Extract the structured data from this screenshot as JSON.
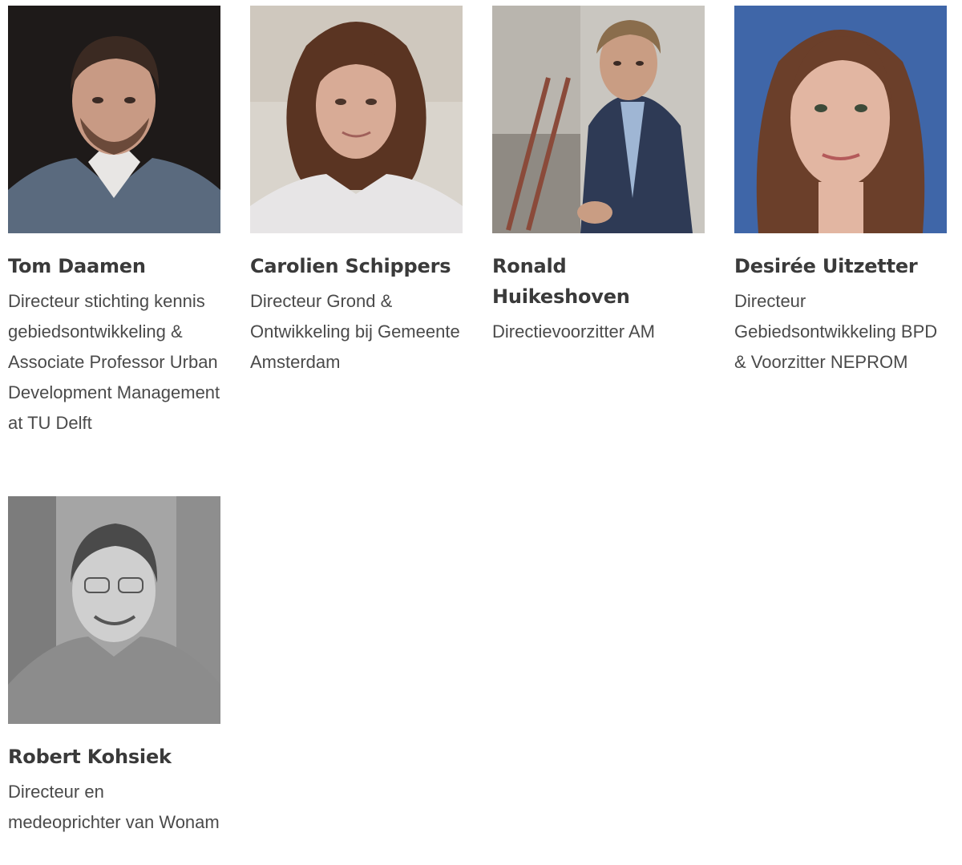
{
  "people": [
    {
      "name": "Tom Daamen",
      "role": "Directeur stichting kennis gebiedsontwikkeling & Associate Professor Urban Development Management at TU Delft",
      "photo_icon": "portrait-photo",
      "photo_colors": {
        "bg": "#1e1a19",
        "skin": "#c89a84",
        "hair": "#3b2a22",
        "suit": "#5a6a7e",
        "shirt": "#e8e6e4"
      }
    },
    {
      "name": "Carolien Schippers",
      "role": "Directeur Grond & Ontwikkeling bij Gemeente Amsterdam",
      "photo_icon": "portrait-photo",
      "photo_colors": {
        "bg": "#d9d4cc",
        "skin": "#d8ab96",
        "hair": "#5a3422",
        "suit": "#e7e5e6",
        "shirt": "#dcdadc"
      }
    },
    {
      "name": "Ronald Huikeshoven",
      "role": "Directievoorzitter AM",
      "photo_icon": "portrait-photo",
      "photo_colors": {
        "bg": "#c9c6c0",
        "skin": "#c99d83",
        "hair": "#8a6d4c",
        "suit": "#2e3a55",
        "shirt": "#9fb6d4"
      }
    },
    {
      "name": "Desirée Uitzetter",
      "role": "Directeur Gebiedsontwikkeling BPD & Voorzitter NEPROM",
      "photo_icon": "portrait-photo",
      "photo_colors": {
        "bg": "#3f66a8",
        "skin": "#e2b6a2",
        "hair": "#6b3f2a",
        "suit": "#3c5b94",
        "shirt": "#e2b6a2"
      }
    },
    {
      "name": "Robert Kohsiek",
      "role": "Directeur en medeoprichter van Wonam",
      "photo_icon": "portrait-photo",
      "photo_colors": {
        "bg": "#a5a5a5",
        "skin": "#cfcfcf",
        "hair": "#4a4a4a",
        "suit": "#8c8c8c",
        "shirt": "#9a9a9a"
      }
    }
  ]
}
